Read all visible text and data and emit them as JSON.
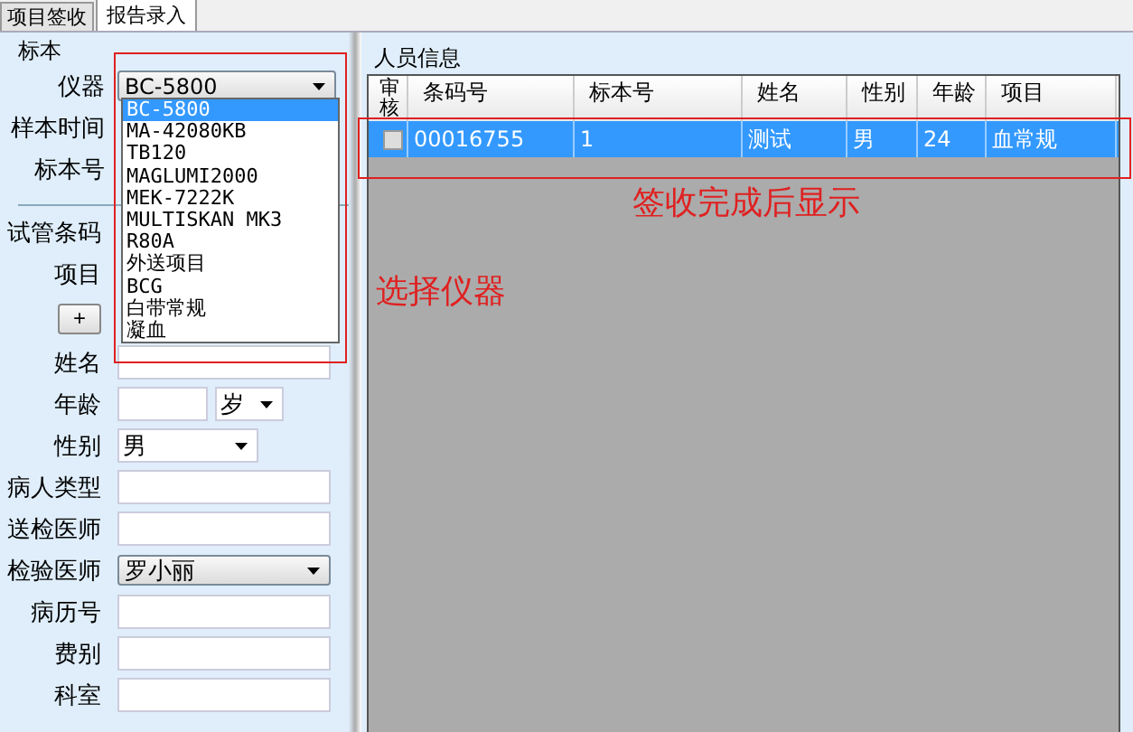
{
  "tabs": [
    {
      "label": "项目签收",
      "selected": false
    },
    {
      "label": "报告录入",
      "selected": true
    }
  ],
  "specimen": {
    "group_label": "标本",
    "instrument": {
      "label": "仪器",
      "value": "BC-5800",
      "options": [
        {
          "label": "BC-5800",
          "selected": true
        },
        {
          "label": "MA-42080KB",
          "selected": false
        },
        {
          "label": "TB120",
          "selected": false
        },
        {
          "label": "MAGLUMI2000",
          "selected": false
        },
        {
          "label": "MEK-7222K",
          "selected": false
        },
        {
          "label": "MULTISKAN MK3",
          "selected": false
        },
        {
          "label": "R80A",
          "selected": false
        },
        {
          "label": "外送项目",
          "selected": false
        },
        {
          "label": "BCG",
          "selected": false
        },
        {
          "label": "白带常规",
          "selected": false
        },
        {
          "label": "凝血",
          "selected": false
        }
      ]
    },
    "labels_top": [
      "样本时间",
      "标本号"
    ],
    "labels_bottom": [
      "试管条码",
      "项目"
    ],
    "add_button": "+"
  },
  "patient_fields": [
    {
      "kind": "text",
      "label": "姓名"
    },
    {
      "kind": "age",
      "label": "年龄",
      "unit": "岁"
    },
    {
      "kind": "select",
      "label": "性别",
      "value": "男"
    },
    {
      "kind": "text",
      "label": "病人类型"
    },
    {
      "kind": "text",
      "label": "送检医师"
    },
    {
      "kind": "combo",
      "label": "检验医师",
      "value": "罗小丽"
    },
    {
      "kind": "text",
      "label": "病历号"
    },
    {
      "kind": "text",
      "label": "费别"
    },
    {
      "kind": "text",
      "label": "科室"
    }
  ],
  "people_info": {
    "title": "人员信息",
    "columns": [
      "审核",
      "条码号",
      "标本号",
      "姓名",
      "性别",
      "年龄",
      "项目"
    ],
    "rows": [
      {
        "checked": false,
        "selected": true,
        "cells": [
          "",
          "00016755",
          "1",
          "测试",
          "男",
          "24",
          "血常规"
        ]
      }
    ]
  },
  "annotations": [
    {
      "text": "选择仪器"
    },
    {
      "text": "签收完成后显示"
    }
  ]
}
